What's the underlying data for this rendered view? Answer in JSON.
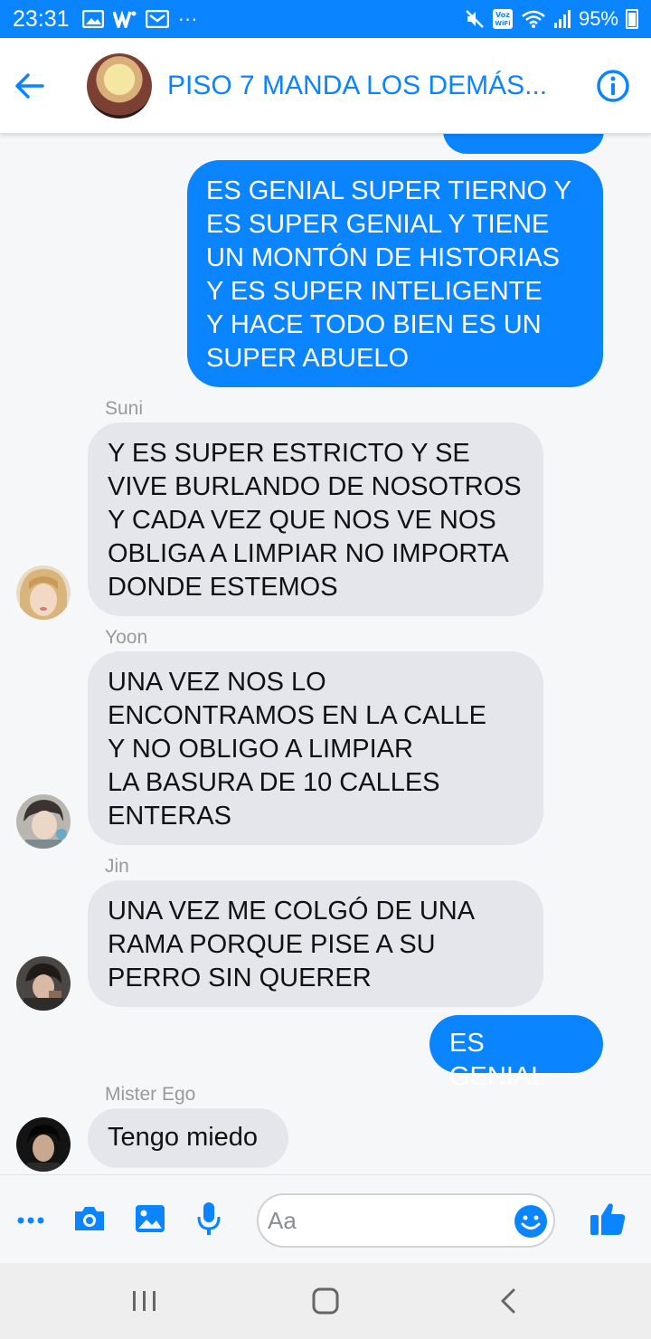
{
  "status_bar": {
    "time": "23:31",
    "battery": "95%",
    "left_icons": [
      "image-icon",
      "w-app-icon",
      "mail-icon",
      "more-dots-icon"
    ],
    "right_icons": [
      "mute-icon",
      "voz-wifi-icon",
      "wifi-icon",
      "signal-icon",
      "battery-icon"
    ],
    "voz_wifi_label": "Voz WiFi",
    "overflow": "···"
  },
  "header": {
    "title": "PISO 7 MANDA LOS DEMÁS...",
    "back_icon": "arrow-left-icon",
    "info_icon": "info-icon",
    "accent_color": "#0a84ff"
  },
  "messages": [
    {
      "type": "outgoing",
      "text": "ES GENIAL SUPER TIERNO Y\nES SUPER GENIAL Y TIENE\nUN MONTÓN DE HISTORIAS\nY ES SUPER INTELIGENTE\nY HACE TODO BIEN ES UN\nSUPER ABUELO"
    },
    {
      "type": "incoming",
      "sender": "Suni",
      "text": "Y ES SUPER ESTRICTO Y SE\nVIVE BURLANDO DE NOSOTROS\nY CADA VEZ QUE NOS VE NOS\nOBLIGA A LIMPIAR NO IMPORTA\nDONDE ESTEMOS"
    },
    {
      "type": "incoming",
      "sender": "Yoon",
      "text": "UNA VEZ NOS LO\nENCONTRAMOS EN LA CALLE\nY NO OBLIGO A LIMPIAR\nLA BASURA DE 10 CALLES\nENTERAS"
    },
    {
      "type": "incoming",
      "sender": "Jin",
      "text": "UNA VEZ ME COLGÓ DE UNA\nRAMA PORQUE PISE A SU\nPERRO SIN QUERER"
    },
    {
      "type": "outgoing",
      "text": "ES GENIAL"
    },
    {
      "type": "incoming",
      "sender": "Mister Ego",
      "text": "Tengo miedo"
    }
  ],
  "composer": {
    "placeholder": "Aa",
    "buttons": [
      "more-icon",
      "camera-icon",
      "gallery-icon",
      "microphone-icon",
      "emoji-icon",
      "thumbs-up-icon"
    ]
  },
  "nav_bar": {
    "buttons": [
      "recents-icon",
      "home-icon",
      "back-icon"
    ]
  }
}
